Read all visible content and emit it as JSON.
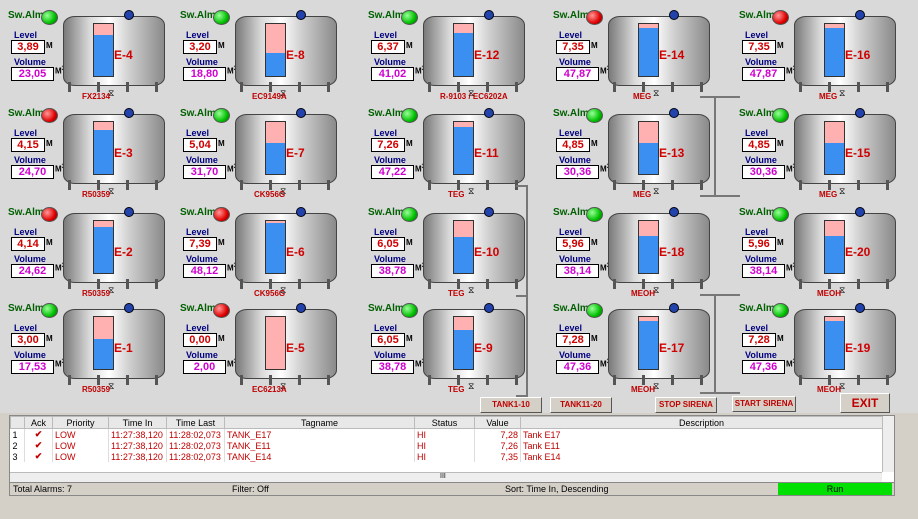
{
  "labels": {
    "swalm": "Sw.Alm",
    "level": "Level",
    "volume": "Volume",
    "unit_m": "M",
    "unit_m3": "M",
    "sup3": "3"
  },
  "tanks": [
    {
      "id": "E-4",
      "sw": "green",
      "level": "3,89",
      "volume": "23,05",
      "fill": 0.78,
      "sub": "FX2134"
    },
    {
      "id": "E-8",
      "sw": "green",
      "level": "3,20",
      "volume": "18,80",
      "fill": 0.45,
      "sub": "EC9149A"
    },
    {
      "id": "E-12",
      "sw": "green",
      "level": "6,37",
      "volume": "41,02",
      "fill": 0.82,
      "sub": "R-9103 / EC6202A"
    },
    {
      "id": "E-14",
      "sw": "red",
      "level": "7,35",
      "volume": "47,87",
      "fill": 0.93,
      "sub": "MEG"
    },
    {
      "id": "E-16",
      "sw": "red",
      "level": "7,35",
      "volume": "47,87",
      "fill": 0.93,
      "sub": "MEG"
    },
    {
      "id": "E-3",
      "sw": "red",
      "level": "4,15",
      "volume": "24,70",
      "fill": 0.85,
      "sub": "R50359"
    },
    {
      "id": "E-7",
      "sw": "green",
      "level": "5,04",
      "volume": "31,70",
      "fill": 0.6,
      "sub": "CK956G"
    },
    {
      "id": "E-11",
      "sw": "green",
      "level": "7,26",
      "volume": "47,22",
      "fill": 0.9,
      "sub": "TEG"
    },
    {
      "id": "E-13",
      "sw": "green",
      "level": "4,85",
      "volume": "30,36",
      "fill": 0.6,
      "sub": "MEG"
    },
    {
      "id": "E-15",
      "sw": "green",
      "level": "4,85",
      "volume": "30,36",
      "fill": 0.6,
      "sub": "MEG"
    },
    {
      "id": "E-2",
      "sw": "red",
      "level": "4,14",
      "volume": "24,62",
      "fill": 0.88,
      "sub": "R50359"
    },
    {
      "id": "E-6",
      "sw": "red",
      "level": "7,39",
      "volume": "48,12",
      "fill": 0.96,
      "sub": "CK956G"
    },
    {
      "id": "E-10",
      "sw": "green",
      "level": "6,05",
      "volume": "38,78",
      "fill": 0.7,
      "sub": "TEG"
    },
    {
      "id": "E-18",
      "sw": "green",
      "level": "5,96",
      "volume": "38,14",
      "fill": 0.72,
      "sub": "MEOH"
    },
    {
      "id": "E-20",
      "sw": "green",
      "level": "5,96",
      "volume": "38,14",
      "fill": 0.72,
      "sub": "MEOH"
    },
    {
      "id": "E-1",
      "sw": "green",
      "level": "3,00",
      "volume": "17,53",
      "fill": 0.57,
      "sub": "R50359"
    },
    {
      "id": "E-5",
      "sw": "red",
      "level": "0,00",
      "volume": "2,00",
      "fill": 0.0,
      "sub": "EC6213A"
    },
    {
      "id": "E-9",
      "sw": "green",
      "level": "6,05",
      "volume": "38,78",
      "fill": 0.75,
      "sub": "TEG"
    },
    {
      "id": "E-17",
      "sw": "green",
      "level": "7,28",
      "volume": "47,36",
      "fill": 0.92,
      "sub": "MEOH"
    },
    {
      "id": "E-19",
      "sw": "green",
      "level": "7,28",
      "volume": "47,36",
      "fill": 0.92,
      "sub": "MEOH"
    }
  ],
  "buttons": {
    "tank1_10": "TANK1-10",
    "tank11_20": "TANK11-20",
    "stop": "STOP SIRENA",
    "start": "START SIRENA",
    "exit": "EXIT"
  },
  "alarm_table": {
    "headers": [
      "",
      "Ack",
      "Priority",
      "Time In",
      "Time Last",
      "Tagname",
      "Status",
      "Value",
      "Description"
    ],
    "rows": [
      [
        "1",
        "✔",
        "LOW",
        "11:27:38,120",
        "11:28:02,073",
        "TANK_E17",
        "HI",
        "7,28",
        "Tank E17"
      ],
      [
        "2",
        "✔",
        "LOW",
        "11:27:38,120",
        "11:28:02,073",
        "TANK_E11",
        "HI",
        "7,26",
        "Tank E11"
      ],
      [
        "3",
        "✔",
        "LOW",
        "11:27:38,120",
        "11:28:02,073",
        "TANK_E14",
        "HI",
        "7,35",
        "Tank E14"
      ]
    ],
    "hscroll_mark": "III"
  },
  "status": {
    "total": "Total Alarms: 7",
    "filter": "Filter: Off",
    "sort": "Sort: Time In, Descending",
    "run": "Run"
  }
}
